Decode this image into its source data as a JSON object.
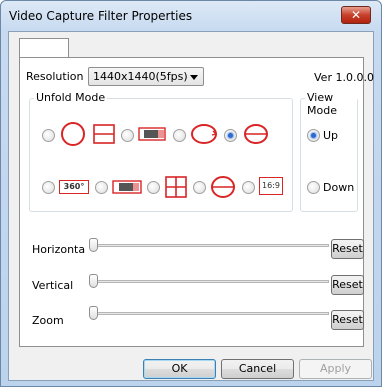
{
  "window": {
    "title": "Video Capture Filter Properties",
    "close_label": "✕"
  },
  "resolution": {
    "label": "Resolution",
    "value": "1440x1440(5fps)"
  },
  "version": "Ver 1.0.0.0",
  "unfold_mode": {
    "title": "Unfold Mode",
    "selected": "ring-dual",
    "row1": [
      "circle",
      "horizontal-split",
      "panorama-strip",
      "ring",
      "ring-dual"
    ],
    "row2": [
      "360-panorama",
      "strip-dark",
      "quad-grid",
      "ellipse-split",
      "16:9"
    ],
    "badge_360": "360°",
    "badge_169": "16:9"
  },
  "view_mode": {
    "title": "View Mode",
    "options": [
      "Up",
      "Down"
    ],
    "selected": "Up"
  },
  "sliders": [
    {
      "label": "Horizonta",
      "value": 0,
      "reset": "Reset"
    },
    {
      "label": "Vertical",
      "value": 0,
      "reset": "Reset"
    },
    {
      "label": "Zoom",
      "value": 0,
      "reset": "Reset"
    }
  ],
  "buttons": {
    "ok": "OK",
    "cancel": "Cancel",
    "apply": "Apply"
  },
  "colors": {
    "accent_red": "#d92525",
    "radio_blue": "#2a6bd1"
  }
}
